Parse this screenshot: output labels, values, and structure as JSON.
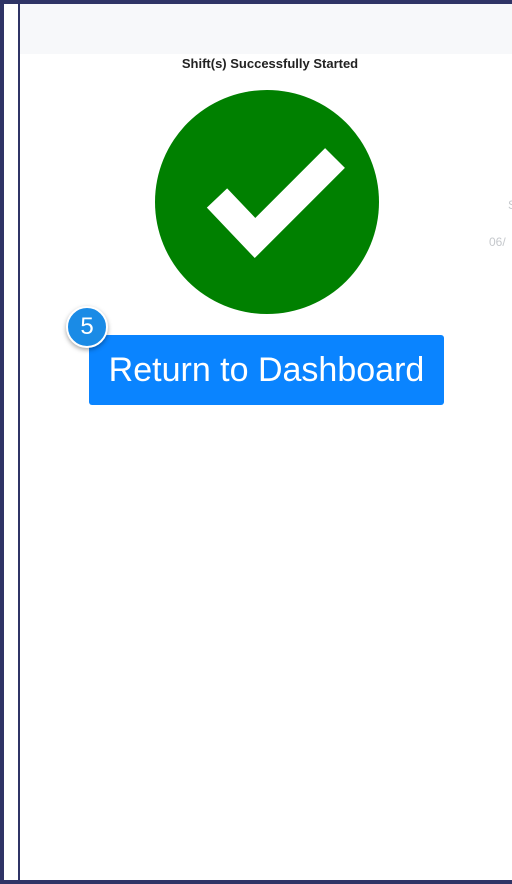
{
  "page": {
    "title": "Shift(s) Successfully Started"
  },
  "status": {
    "icon": "checkmark-icon",
    "color": "#008000"
  },
  "background_text": {
    "line1": "S",
    "line2": "06/"
  },
  "actions": {
    "return_label": "Return to Dashboard",
    "return_color": "#0a84ff"
  },
  "tutorial": {
    "step_number": "5"
  }
}
